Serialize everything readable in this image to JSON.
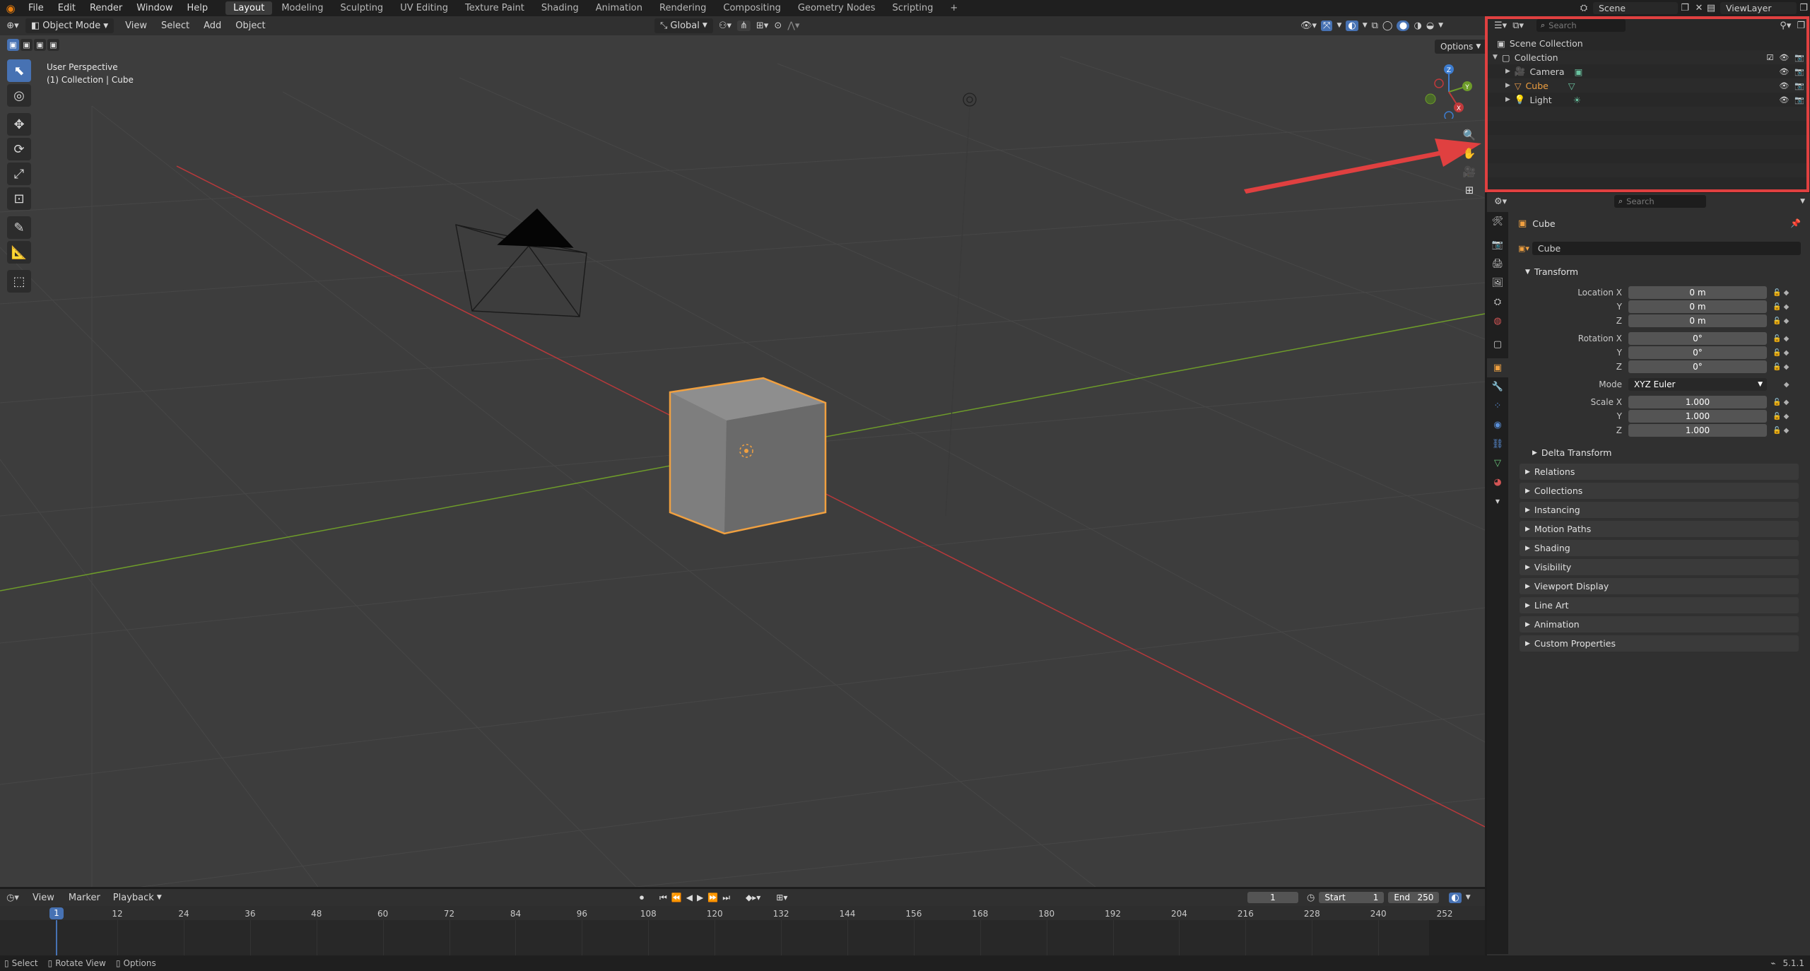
{
  "colors": {
    "accent": "#4772b3",
    "selection_orange": "#f0a040",
    "highlight_red": "#e04040",
    "x_axis": "#c0393b",
    "y_axis": "#6e9c2a",
    "z_axis": "#3d7ccf"
  },
  "topbar": {
    "menus": [
      "File",
      "Edit",
      "Render",
      "Window",
      "Help"
    ],
    "workspaces": [
      "Layout",
      "Modeling",
      "Sculpting",
      "UV Editing",
      "Texture Paint",
      "Shading",
      "Animation",
      "Rendering",
      "Compositing",
      "Geometry Nodes",
      "Scripting"
    ],
    "active_workspace": "Layout",
    "add_tab": "+",
    "scene": "Scene",
    "view_layer": "ViewLayer"
  },
  "viewport_header": {
    "mode": "Object Mode",
    "menus": [
      "View",
      "Select",
      "Add",
      "Object"
    ],
    "orientation": "Global",
    "options": "Options"
  },
  "viewport": {
    "perspective": "User Perspective",
    "context": "(1) Collection | Cube",
    "gizmo_labels": {
      "x": "X",
      "y": "Y",
      "z": "Z"
    }
  },
  "outliner": {
    "search_placeholder": "Search",
    "items": [
      {
        "label": "Scene Collection",
        "icon": "scene-collection-icon"
      },
      {
        "label": "Collection",
        "icon": "collection-icon"
      },
      {
        "label": "Camera",
        "icon": "camera-icon"
      },
      {
        "label": "Cube",
        "icon": "mesh-icon",
        "selected": true
      },
      {
        "label": "Light",
        "icon": "light-icon"
      }
    ]
  },
  "properties": {
    "search_placeholder": "Search",
    "object_name": "Cube",
    "datablock_name": "Cube",
    "transform": {
      "header": "Transform",
      "location_label": "Location X",
      "rotation_label": "Rotation X",
      "scale_label": "Scale X",
      "y_label": "Y",
      "z_label": "Z",
      "location": [
        "0 m",
        "0 m",
        "0 m"
      ],
      "rotation": [
        "0°",
        "0°",
        "0°"
      ],
      "mode_label": "Mode",
      "mode": "XYZ Euler",
      "scale": [
        "1.000",
        "1.000",
        "1.000"
      ],
      "delta": "Delta Transform"
    },
    "panels": [
      "Relations",
      "Collections",
      "Instancing",
      "Motion Paths",
      "Shading",
      "Visibility",
      "Viewport Display",
      "Line Art",
      "Animation",
      "Custom Properties"
    ]
  },
  "timeline": {
    "menus": [
      "View",
      "Marker",
      "Playback"
    ],
    "current_frame": "1",
    "start_label": "Start",
    "start": "1",
    "end_label": "End",
    "end": "250",
    "ruler": [
      "1",
      "12",
      "24",
      "36",
      "48",
      "60",
      "72",
      "84",
      "96",
      "108",
      "120",
      "132",
      "144",
      "156",
      "168",
      "180",
      "192",
      "204",
      "216",
      "228",
      "240",
      "252"
    ]
  },
  "statusbar": {
    "select": "Select",
    "rotate": "Rotate View",
    "options": "Options",
    "version": "5.1.1"
  }
}
